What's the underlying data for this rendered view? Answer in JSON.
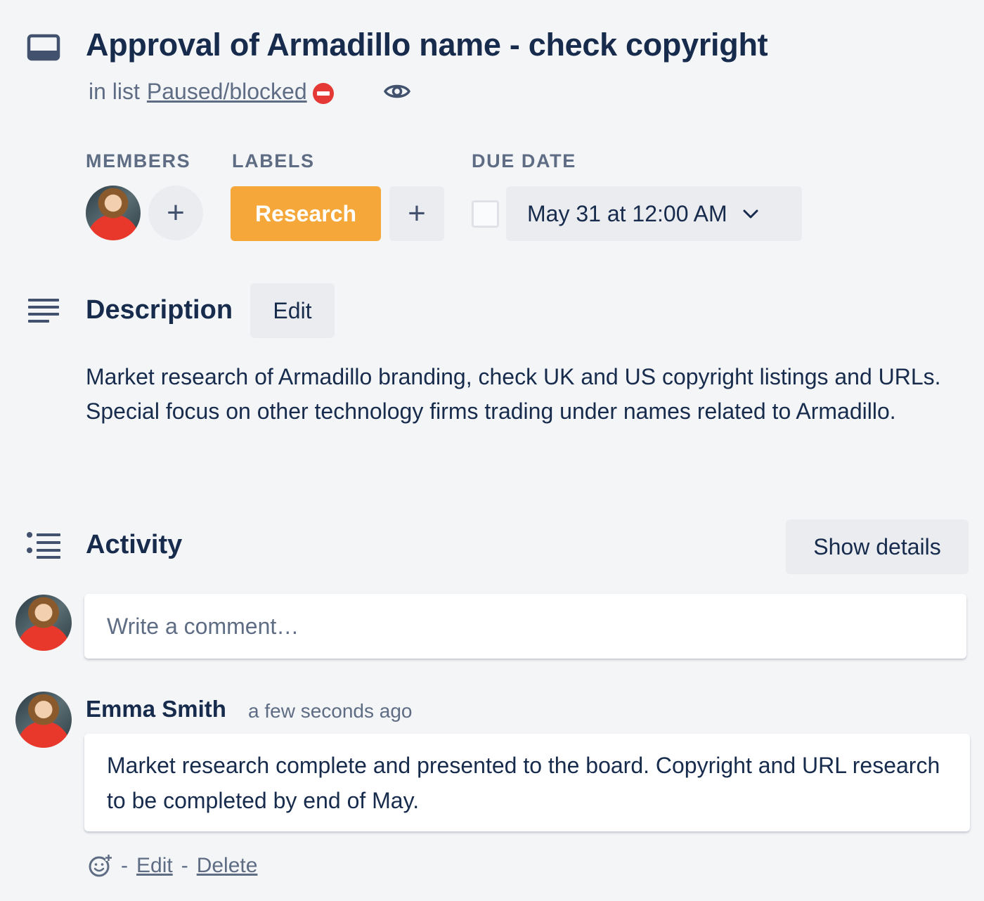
{
  "card": {
    "title": "Approval of Armadillo name - check copyright",
    "list_prefix": "in list",
    "list_name": "Paused/blocked"
  },
  "sections": {
    "members_label": "MEMBERS",
    "labels_label": "LABELS",
    "due_label": "DUE DATE"
  },
  "labels": [
    {
      "text": "Research",
      "color": "#f6a73a"
    }
  ],
  "due_date": {
    "value": "May 31 at 12:00 AM",
    "completed": false
  },
  "add_symbol": "+",
  "description": {
    "title": "Description",
    "edit_label": "Edit",
    "text": "Market research of Armadillo branding, check UK and US copyright listings and URLs. Special focus on other technology firms trading under names related to Armadillo."
  },
  "activity": {
    "title": "Activity",
    "show_details_label": "Show details",
    "comment_placeholder": "Write a comment…",
    "comments": [
      {
        "author": "Emma Smith",
        "time": "a few seconds ago",
        "text": "Market research complete and presented to the board. Copyright and URL research to be completed by end of May.",
        "sep": "-",
        "edit_label": "Edit",
        "delete_label": "Delete"
      }
    ]
  },
  "icons": {
    "card": "card-icon",
    "watch": "eye-icon",
    "description": "text-lines-icon",
    "activity": "activity-list-icon",
    "reaction": "add-reaction-icon",
    "no_entry": "no-entry-icon",
    "dropdown": "chevron-down-icon"
  },
  "colors": {
    "background": "#f4f5f7",
    "text": "#172b4d",
    "muted": "#5e6c84",
    "button_bg": "#ebecf0",
    "label_orange": "#f6a73a"
  }
}
